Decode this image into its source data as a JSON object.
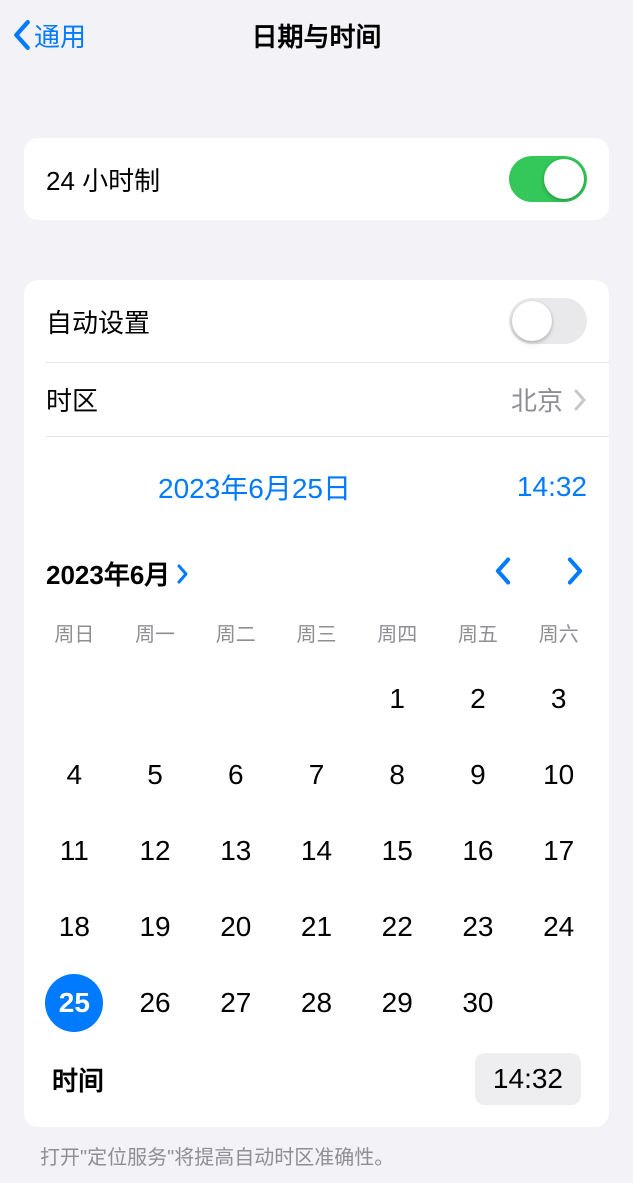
{
  "nav": {
    "back_label": "通用",
    "title": "日期与时间"
  },
  "settings": {
    "twenty_four_hour_label": "24 小时制",
    "twenty_four_hour_on": true,
    "auto_set_label": "自动设置",
    "auto_set_on": false,
    "timezone_label": "时区",
    "timezone_value": "北京"
  },
  "date_time": {
    "date_display": "2023年6月25日",
    "time_display": "14:32"
  },
  "calendar": {
    "month_label": "2023年6月",
    "days_of_week": [
      "周日",
      "周一",
      "周二",
      "周三",
      "周四",
      "周五",
      "周六"
    ],
    "leading_blanks": 4,
    "days_in_month": 30,
    "selected_day": 25
  },
  "time_picker": {
    "label": "时间",
    "value": "14:32"
  },
  "footer": {
    "text": "打开\"定位服务\"将提高自动时区准确性。"
  }
}
